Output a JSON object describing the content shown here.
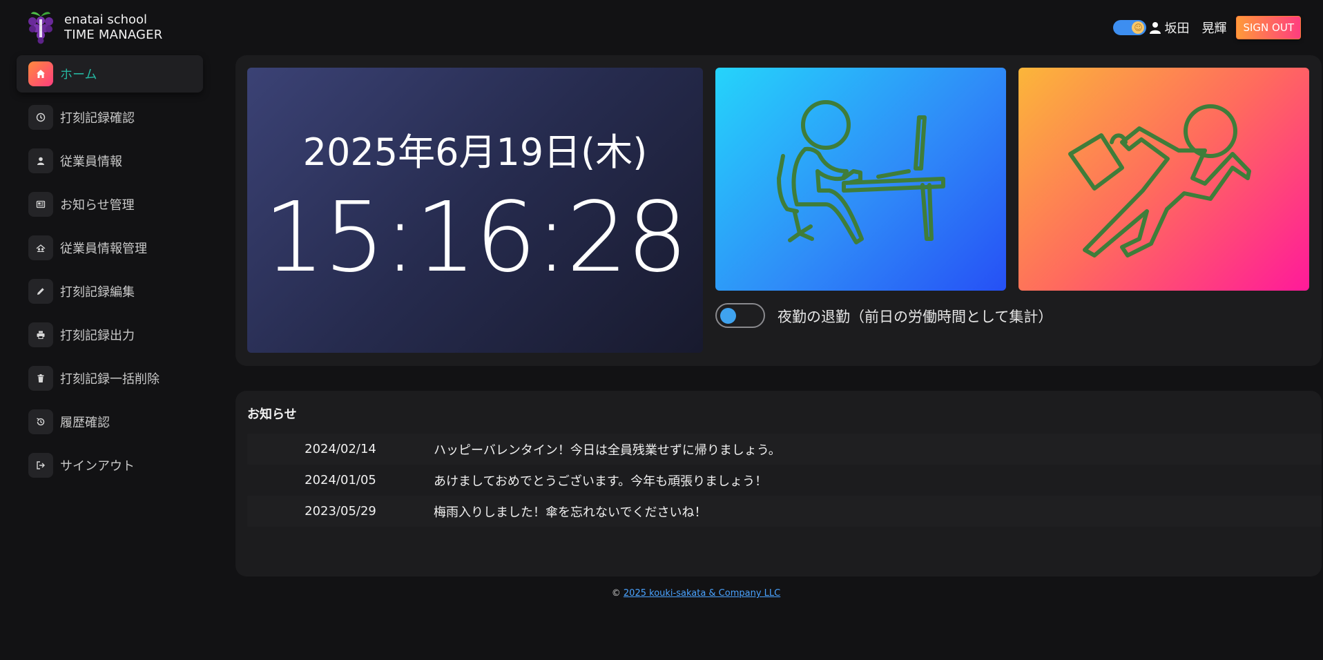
{
  "header": {
    "brand_line1": "enatai school",
    "brand_line2": "TIME MANAGER",
    "user_name": "坂田　晃輝",
    "signout_label": "SIGN OUT",
    "theme_toggle_icon": "smiley-icon",
    "accent_gradient": [
      "#ff9a3a",
      "#ff3d7f"
    ]
  },
  "sidebar": {
    "items": [
      {
        "label": "ホーム",
        "icon": "home-icon",
        "active": true
      },
      {
        "label": "打刻記録確認",
        "icon": "clock-icon"
      },
      {
        "label": "従業員情報",
        "icon": "person-icon"
      },
      {
        "label": "お知らせ管理",
        "icon": "newspaper-icon"
      },
      {
        "label": "従業員情報管理",
        "icon": "people-manage-icon"
      },
      {
        "label": "打刻記録編集",
        "icon": "pencil-icon"
      },
      {
        "label": "打刻記録出力",
        "icon": "printer-icon"
      },
      {
        "label": "打刻記録一括削除",
        "icon": "trash-icon"
      },
      {
        "label": "履歴確認",
        "icon": "history-icon"
      },
      {
        "label": "サインアウト",
        "icon": "logout-icon"
      }
    ],
    "active_color": "#26b5a0"
  },
  "clock": {
    "date": "2025年6月19日(木)",
    "time": "15:16:28"
  },
  "punch": {
    "clock_in_icon": "desk-worker-icon",
    "clock_out_icon": "running-person-icon",
    "night_shift_label": "夜勤の退勤（前日の労働時間として集計）"
  },
  "news": {
    "title": "お知らせ",
    "rows": [
      {
        "date": "2024/02/14",
        "text": "ハッピーバレンタイン！今日は全員残業せずに帰りましょう。"
      },
      {
        "date": "2024/01/05",
        "text": "あけましておめでとうございます。今年も頑張りましょう！"
      },
      {
        "date": "2023/05/29",
        "text": "梅雨入りしました！傘を忘れないでくださいね！"
      }
    ]
  },
  "footer": {
    "copyright": "©",
    "link_text": "2025 kouki-sakata & Company LLC"
  }
}
